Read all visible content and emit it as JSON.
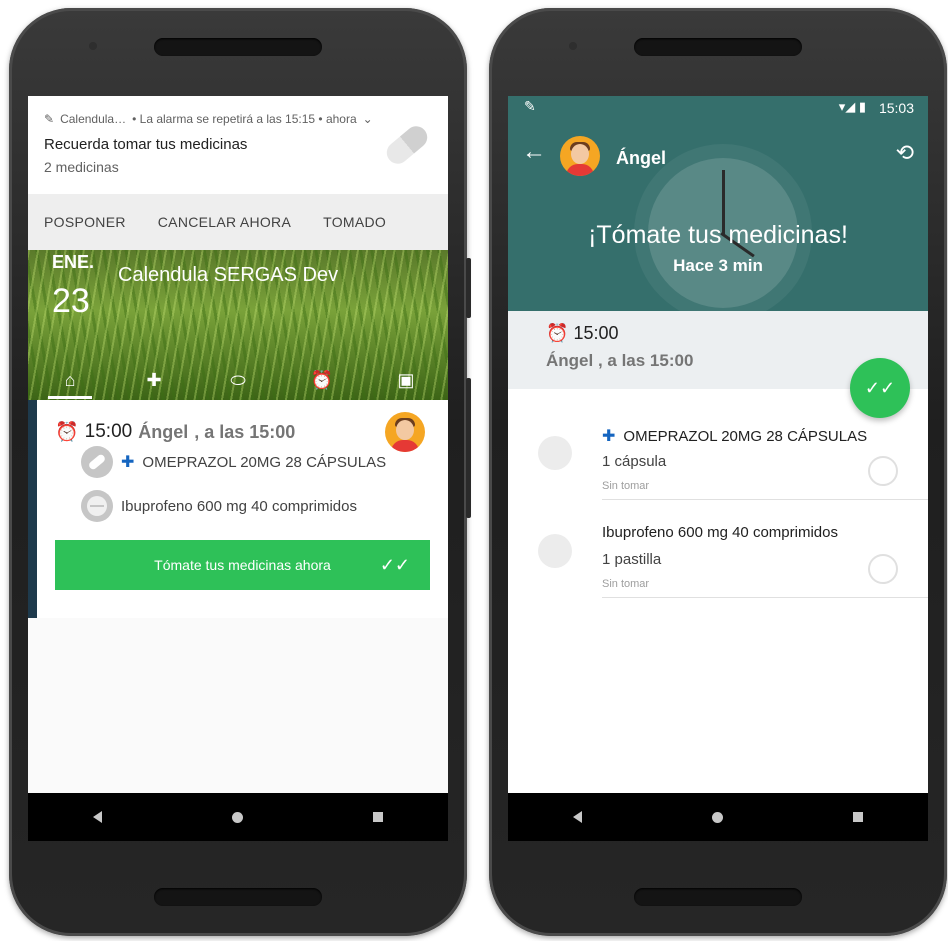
{
  "left": {
    "notification": {
      "app": "Calendula…",
      "detail": "• La alarma se repetirá a las 15:15 • ahora",
      "title": "Recuerda tomar tus medicinas",
      "subtitle": "2 medicinas",
      "actions": [
        "POSPONER",
        "CANCELAR AHORA",
        "TOMADO"
      ]
    },
    "banner": {
      "month": "ENE.",
      "day": "23",
      "title": "Calendula SERGAS Dev"
    },
    "card": {
      "time": "15:00",
      "patient": "Ángel",
      "at": ", a las 15:00",
      "meds": [
        "OMEPRAZOL 20MG 28 CÁPSULAS",
        "Ibuprofeno 600 mg 40 comprimidos"
      ],
      "take_button": "Tómate tus medicinas ahora"
    }
  },
  "right": {
    "status_time": "15:03",
    "patient": "Ángel",
    "headline": "¡Tómate tus medicinas!",
    "ago": "Hace 3 min",
    "time": "15:00",
    "who": "Ángel , a las 15:00",
    "items": [
      {
        "name": "OMEPRAZOL 20MG 28 CÁPSULAS",
        "dose": "1 cápsula",
        "status": "Sin tomar"
      },
      {
        "name": "Ibuprofeno 600 mg 40 comprimidos",
        "dose": "1 pastilla",
        "status": "Sin tomar"
      }
    ]
  },
  "colors": {
    "green": "#2ec158",
    "teal": "#356f6c",
    "blue": "#1565c0"
  },
  "icons": [
    "pencil-icon",
    "home-icon",
    "pill-icon",
    "alarm-icon",
    "calendar-icon",
    "back-arrow-icon",
    "history-icon",
    "double-check-icon",
    "pharmacy-cross-icon"
  ]
}
